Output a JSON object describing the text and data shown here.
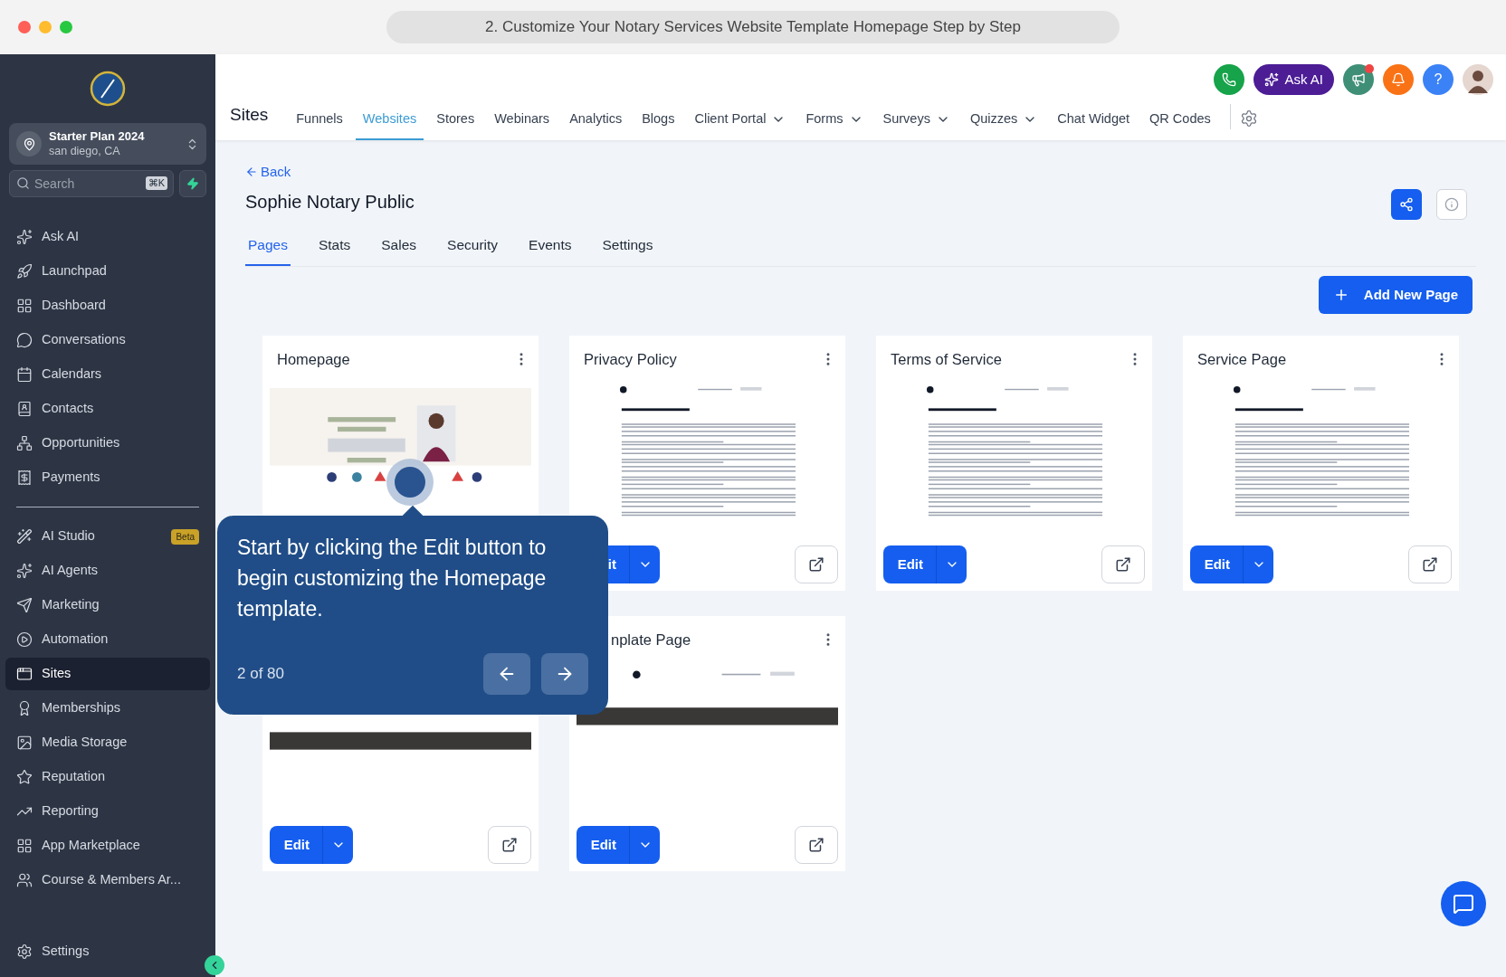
{
  "window": {
    "title": "2. Customize Your Notary Services Website Template Homepage Step by Step"
  },
  "sidebar": {
    "account": {
      "name": "Starter Plan 2024",
      "location": "san diego, CA"
    },
    "search": {
      "placeholder": "Search",
      "shortcut": "⌘K"
    },
    "groups": [
      [
        {
          "label": "Ask AI",
          "selected": false
        },
        {
          "label": "Launchpad",
          "selected": false
        },
        {
          "label": "Dashboard",
          "selected": false
        },
        {
          "label": "Conversations",
          "selected": false
        },
        {
          "label": "Calendars",
          "selected": false
        },
        {
          "label": "Contacts",
          "selected": false
        },
        {
          "label": "Opportunities",
          "selected": false
        },
        {
          "label": "Payments",
          "selected": false
        }
      ],
      [
        {
          "label": "AI Studio",
          "selected": false,
          "badge": "Beta"
        },
        {
          "label": "AI Agents",
          "selected": false
        },
        {
          "label": "Marketing",
          "selected": false
        },
        {
          "label": "Automation",
          "selected": false
        },
        {
          "label": "Sites",
          "selected": true
        },
        {
          "label": "Memberships",
          "selected": false
        },
        {
          "label": "Media Storage",
          "selected": false
        },
        {
          "label": "Reputation",
          "selected": false
        },
        {
          "label": "Reporting",
          "selected": false
        },
        {
          "label": "App Marketplace",
          "selected": false
        },
        {
          "label": "Course & Members Ar...",
          "selected": false
        }
      ]
    ],
    "footer": {
      "label": "Settings"
    }
  },
  "topbar": {
    "section": "Sites",
    "ask_ai": "Ask AI",
    "help": "?",
    "notification_dot": true,
    "tabs": [
      {
        "label": "Funnels",
        "selected": false,
        "dropdown": false
      },
      {
        "label": "Websites",
        "selected": true,
        "dropdown": false
      },
      {
        "label": "Stores",
        "selected": false,
        "dropdown": false
      },
      {
        "label": "Webinars",
        "selected": false,
        "dropdown": false
      },
      {
        "label": "Analytics",
        "selected": false,
        "dropdown": false
      },
      {
        "label": "Blogs",
        "selected": false,
        "dropdown": false
      },
      {
        "label": "Client Portal",
        "selected": false,
        "dropdown": true
      },
      {
        "label": "Forms",
        "selected": false,
        "dropdown": true
      },
      {
        "label": "Surveys",
        "selected": false,
        "dropdown": true
      },
      {
        "label": "Quizzes",
        "selected": false,
        "dropdown": true
      },
      {
        "label": "Chat Widget",
        "selected": false,
        "dropdown": false
      },
      {
        "label": "QR Codes",
        "selected": false,
        "dropdown": false
      }
    ]
  },
  "site": {
    "back": "Back",
    "name": "Sophie Notary Public",
    "add_button": "Add New Page",
    "tabs": [
      {
        "label": "Pages",
        "selected": true
      },
      {
        "label": "Stats",
        "selected": false
      },
      {
        "label": "Sales",
        "selected": false
      },
      {
        "label": "Security",
        "selected": false
      },
      {
        "label": "Events",
        "selected": false
      },
      {
        "label": "Settings",
        "selected": false
      }
    ]
  },
  "cards": [
    {
      "title": "Homepage",
      "kind": "hero"
    },
    {
      "title": "Privacy Policy",
      "kind": "document",
      "edit": "it",
      "open": true
    },
    {
      "title": "Terms of Service",
      "kind": "document",
      "edit": "Edit",
      "open": true
    },
    {
      "title": "Service Page",
      "kind": "document",
      "edit": "Edit",
      "open": true
    },
    {
      "kind": "band",
      "edit": "Edit",
      "open": true
    },
    {
      "title": "nplate Page",
      "kind": "footer",
      "edit": "Edit",
      "open": true
    }
  ],
  "tour": {
    "text": "Start by clicking the Edit button to begin customizing the Homepage template.",
    "progress": "2 of 80"
  }
}
